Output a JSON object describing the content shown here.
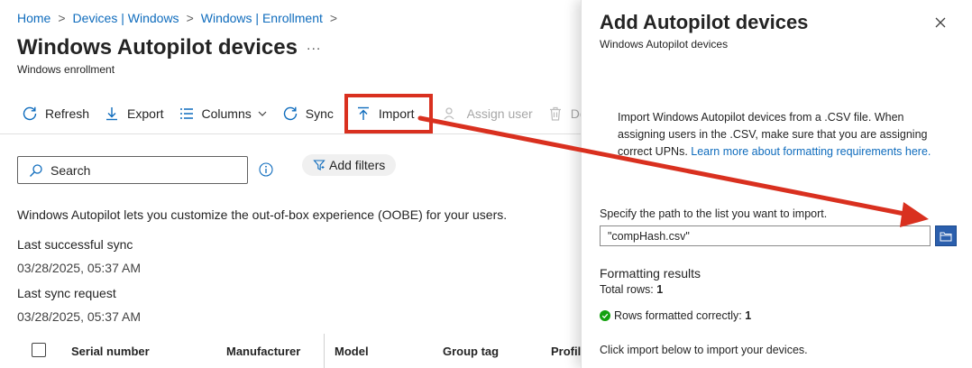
{
  "breadcrumb": [
    {
      "label": "Home"
    },
    {
      "label": "Devices | Windows"
    },
    {
      "label": "Windows | Enrollment"
    }
  ],
  "breadcrumb_separator": ">",
  "page": {
    "title": "Windows Autopilot devices",
    "more": "...",
    "subtitle": "Windows enrollment"
  },
  "toolbar": {
    "refresh": "Refresh",
    "export": "Export",
    "columns": "Columns",
    "sync": "Sync",
    "import": "Import",
    "assign_user": "Assign user",
    "delete": "Delete"
  },
  "search": {
    "placeholder": "Search"
  },
  "filters": {
    "add_label": "Add filters"
  },
  "description": "Windows Autopilot lets you customize the out-of-box experience (OOBE) for your users.",
  "sync_info": {
    "last_successful_label": "Last successful sync",
    "last_successful_value": "03/28/2025, 05:37 AM",
    "last_request_label": "Last sync request",
    "last_request_value": "03/28/2025, 05:37 AM"
  },
  "table": {
    "columns": [
      "Serial number",
      "Manufacturer",
      "Model",
      "Group tag",
      "Profil"
    ]
  },
  "panel": {
    "title": "Add Autopilot devices",
    "subtitle": "Windows Autopilot devices",
    "description": "Import Windows Autopilot devices from a .CSV file. When assigning users in the .CSV, make sure that you are assigning correct UPNs.",
    "learn_more": "Learn more about formatting requirements here.",
    "path_label": "Specify the path to the list you want to import.",
    "path_value": "\"compHash.csv\"",
    "formatting_title": "Formatting results",
    "total_rows_label": "Total rows:",
    "total_rows_value": "1",
    "rows_ok_label": "Rows formatted correctly:",
    "rows_ok_value": "1",
    "import_note": "Click import below to import your devices."
  },
  "colors": {
    "link": "#0f6cbd",
    "annotation": "#d9301f",
    "success": "#13a10e",
    "browse_button": "#2b5fad"
  }
}
